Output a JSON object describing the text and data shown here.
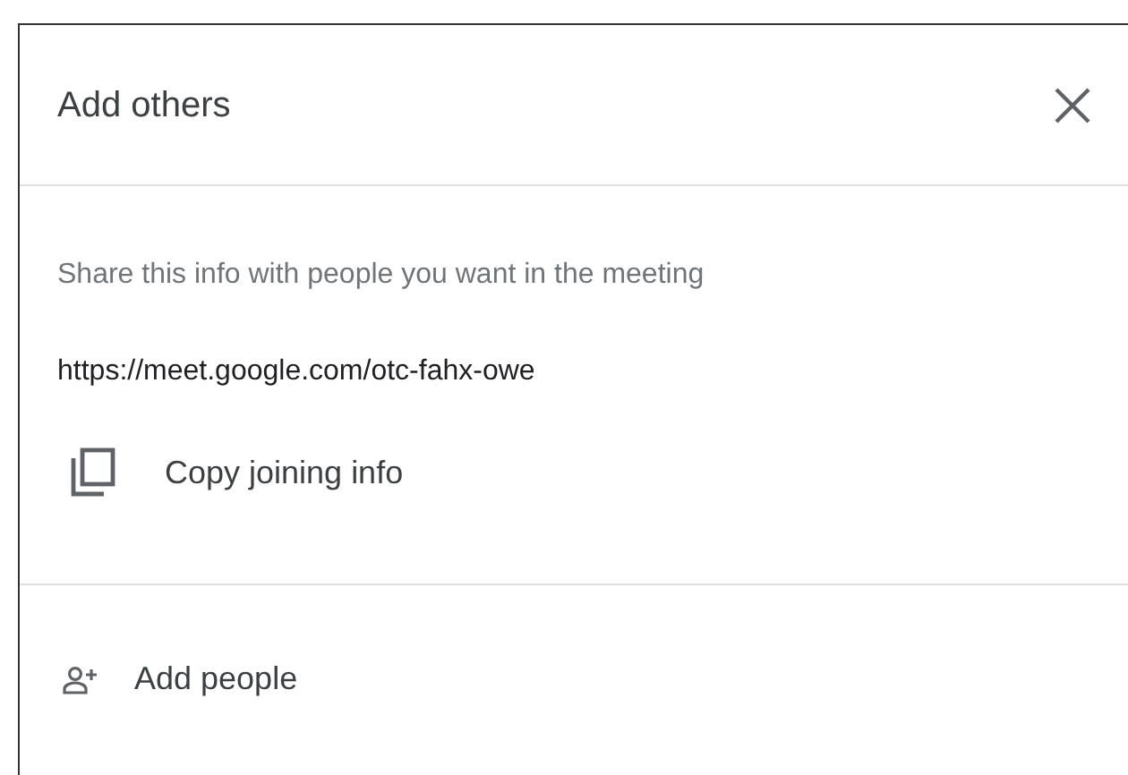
{
  "dialog": {
    "title": "Add others"
  },
  "share": {
    "hint": "Share this info with people you want in the meeting",
    "link": "https://meet.google.com/otc-fahx-owe"
  },
  "actions": [
    {
      "kind": "copy",
      "label": "Copy joining info"
    },
    {
      "kind": "add-people",
      "label": "Add people"
    }
  ]
}
